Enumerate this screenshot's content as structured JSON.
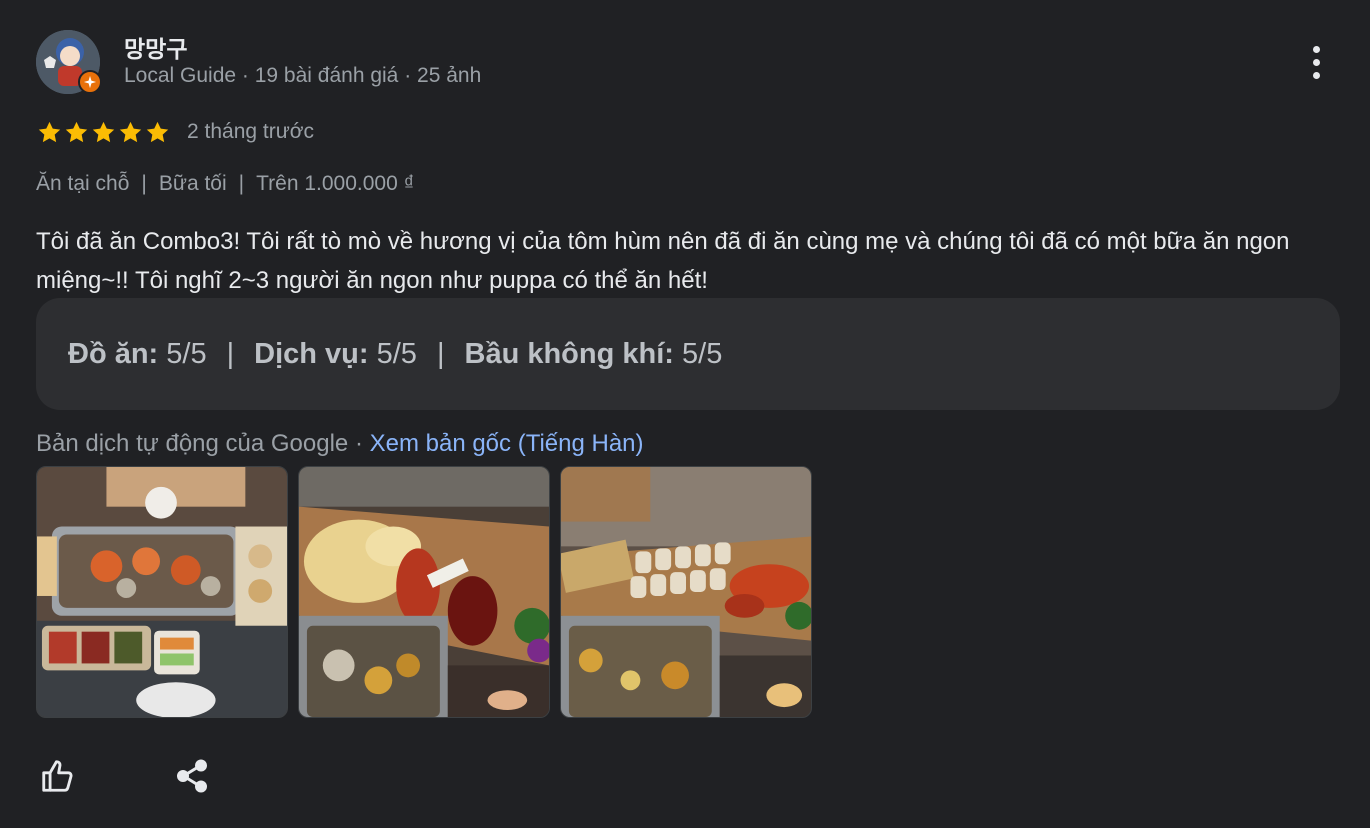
{
  "reviewer": {
    "name": "망망구",
    "meta": "Local Guide · 19 bài đánh giá · 25 ảnh",
    "avatar_icon": "avatar-character",
    "badge_icon": "local-guide-badge-icon"
  },
  "rating": {
    "stars": 5,
    "max_stars": 5,
    "star_color": "#fbbc04",
    "time_ago": "2 tháng trước"
  },
  "attributes": [
    "Ăn tại chỗ",
    "Bữa tối",
    "Trên 1.000.000 ₫"
  ],
  "review": {
    "text": "Tôi đã ăn Combo3! Tôi rất tò mò về hương vị của tôm hùm nên đã đi ăn cùng mẹ và chúng tôi đã có một bữa ăn ngon miệng~!! Tôi nghĩ 2~3 người ăn ngon như puppa có thể ăn hết!"
  },
  "scores": [
    {
      "label": "Đồ ăn:",
      "value": "5/5"
    },
    {
      "label": "Dịch vụ:",
      "value": "5/5"
    },
    {
      "label": "Bầu không khí:",
      "value": "5/5"
    }
  ],
  "translation": {
    "note": "Bản dịch tự động của Google",
    "separator": " · ",
    "link": "Xem bản gốc (Tiếng Hàn)"
  },
  "photos": [
    {
      "name": "photo-seafood-table"
    },
    {
      "name": "photo-lobster-board"
    },
    {
      "name": "photo-lobster-rolls"
    }
  ],
  "actions": {
    "like_icon": "thumbs-up-icon",
    "share_icon": "share-icon"
  },
  "colors": {
    "background": "#202124",
    "text": "#e8eaed",
    "muted": "#9aa0a6",
    "link": "#8ab4f8",
    "scores_bg": "#2d2e31",
    "badge": "#e8710a"
  }
}
